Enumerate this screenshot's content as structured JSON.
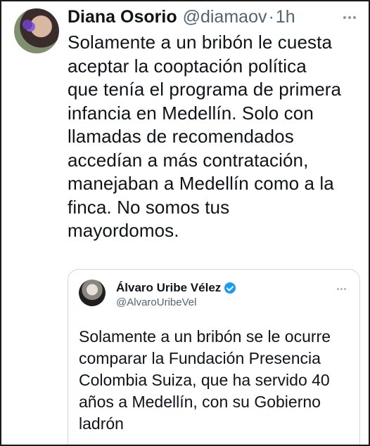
{
  "tweet": {
    "author_name": "Diana Osorio",
    "handle": "@diamaov",
    "separator": "·",
    "time": "1h",
    "text": "Solamente a un bribón le cuesta\naceptar la cooptación política\nque tenía el programa de primera\ninfancia en Medellín. Solo con\nllamadas de recomendados\naccedían a más contratación,\nmanejaban a Medellín como a la\nfinca. No somos tus\nmayordomos."
  },
  "quoted_tweet": {
    "author_name": "Álvaro Uribe Vélez",
    "handle": "@AlvaroUribeVel",
    "verified": true,
    "text": "Solamente a un bribón se le ocurre\ncomparar la Fundación Presencia\nColombia Suiza, que ha servido 40\naños a Medellín, con su Gobierno\nladrón"
  },
  "colors": {
    "text": "#0f1419",
    "muted": "#536471",
    "border": "#cfd9de",
    "verified": "#1d9bf0"
  },
  "icons": {
    "more": "more-horizontal-icon",
    "verified": "verified-badge-icon"
  }
}
